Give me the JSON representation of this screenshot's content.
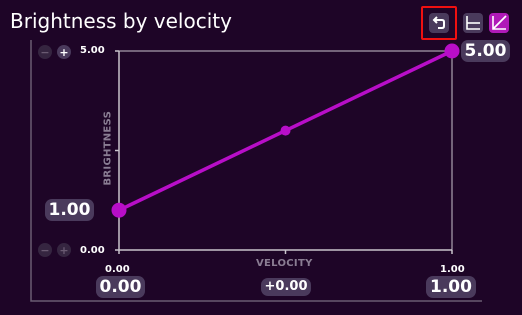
{
  "title": "Brightness by velocity",
  "toolbar": {
    "undo_icon": "undo-icon",
    "step_icon": "step-curve-icon",
    "linear_icon": "linear-curve-icon",
    "focused_button": "undo"
  },
  "zoom": {
    "top_minus": "−",
    "top_plus": "+",
    "bottom_minus": "−",
    "bottom_plus": "+"
  },
  "y_axis": {
    "name": "BRIGHTNESS",
    "max_tick": "5.00",
    "min_tick": "0.00"
  },
  "x_axis": {
    "name": "VELOCITY",
    "min_tick": "0.00",
    "max_tick": "1.00"
  },
  "values": {
    "start_y": "1.00",
    "end_y": "5.00",
    "start_x": "0.00",
    "end_x": "1.00",
    "offset": "+0.00"
  },
  "chart_data": {
    "type": "line",
    "x": [
      0.0,
      0.5,
      1.0
    ],
    "y": [
      1.0,
      3.0,
      5.0
    ],
    "xlim": [
      0,
      1
    ],
    "ylim": [
      0,
      5
    ],
    "xlabel": "VELOCITY",
    "ylabel": "BRIGHTNESS",
    "line_color": "#b80ec8",
    "endpoints": [
      0,
      2
    ],
    "midpoint": 1
  },
  "colors": {
    "background": "#1e0527",
    "axis": "#c9c4cc",
    "curve": "#b80ec8",
    "pill": "#4a3a5c",
    "focus": "#f01010",
    "active_button": "#b01ab8"
  }
}
